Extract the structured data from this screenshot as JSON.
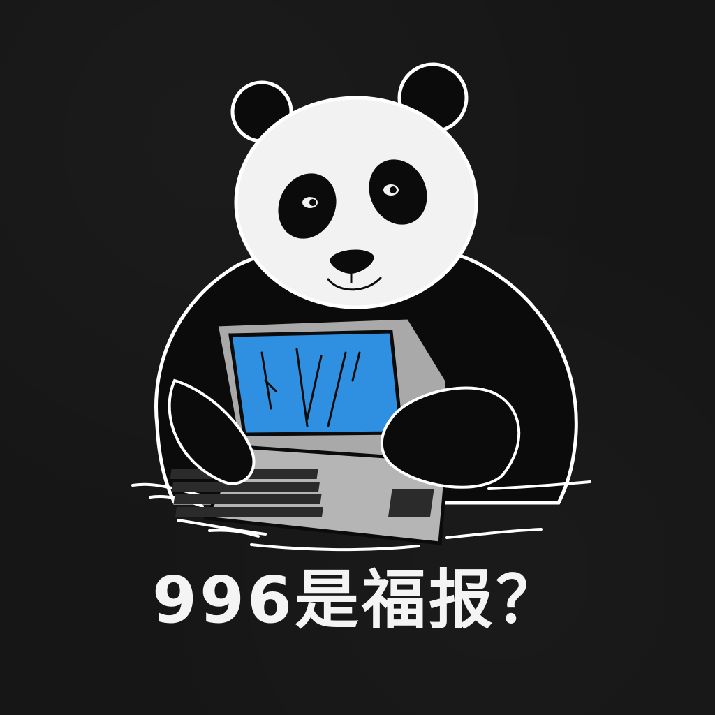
{
  "caption": {
    "text": "996是福报？"
  },
  "colors": {
    "background": "#161616",
    "panda_white": "#f2f2f2",
    "panda_black": "#0b0b0b",
    "outline": "#ffffff",
    "laptop_gray": "#a9a9a9",
    "screen_blue": "#2f8fe0"
  },
  "icons": {
    "figure": "panda-icon",
    "device": "laptop-icon"
  }
}
